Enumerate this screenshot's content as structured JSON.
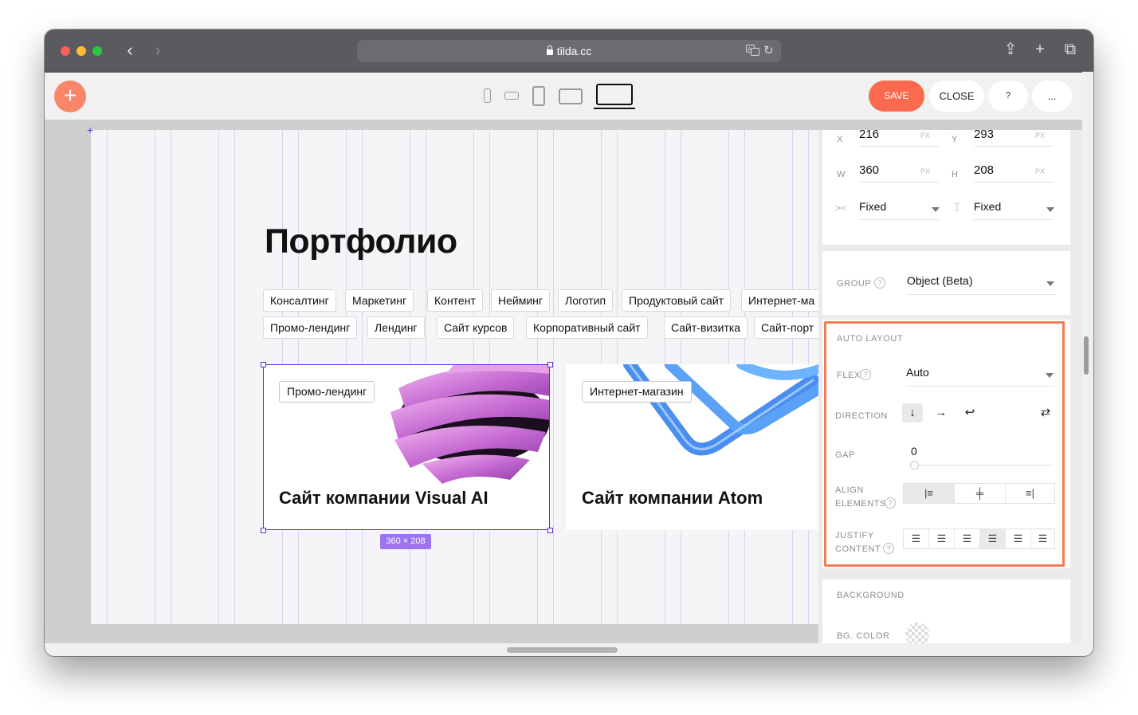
{
  "browser": {
    "url": "tilda.cc",
    "translate_icon": "translate-icon",
    "reload_icon": "reload-icon",
    "back_glyph": "‹",
    "forward_glyph": "›",
    "share_glyph": "⇪",
    "newtab_glyph": "+",
    "tabs_glyph": "⧉"
  },
  "toolbar": {
    "add_glyph": "+",
    "save_label": "SAVE",
    "close_label": "CLOSE",
    "help_label": "?",
    "more_label": "...",
    "accent_color": "#fa6a4e"
  },
  "page": {
    "title": "Портфолио",
    "tags_row1": [
      "Консалтинг",
      "Маркетинг",
      "Контент",
      "Нейминг",
      "Логотип",
      "Продуктовый сайт",
      "Интернет-ма"
    ],
    "tags_row2": [
      "Промо-лендинг",
      "Лендинг",
      "Сайт курсов",
      "Корпоративный сайт",
      "Сайт-визитка",
      "Сайт-порт"
    ],
    "cards": [
      {
        "tag": "Промо-лендинг",
        "title": "Сайт компании Visual AI"
      },
      {
        "tag": "Интернет-магазин",
        "title": "Сайт компании Atom"
      }
    ],
    "selection_size": "360 × 208"
  },
  "panel": {
    "x_label": "X",
    "x_value": "216",
    "x_unit": "PX",
    "y_label": "Y",
    "y_value": "293",
    "y_unit": "PX",
    "w_label": "W",
    "w_value": "360",
    "w_unit": "PX",
    "h_label": "H",
    "h_value": "208",
    "h_unit": "PX",
    "w_mode": "Fixed",
    "h_mode": "Fixed",
    "group_label": "GROUP",
    "group_value": "Object (Beta)",
    "auto_layout_title": "AUTO LAYOUT",
    "flex_label": "FLEX",
    "flex_value": "Auto",
    "direction_label": "DIRECTION",
    "direction_icons": [
      "↓",
      "→",
      "↩",
      "⇄"
    ],
    "gap_label": "GAP",
    "gap_value": "0",
    "align_label_1": "ALIGN",
    "align_label_2": "ELEMENTS",
    "justify_label_1": "JUSTIFY",
    "justify_label_2": "CONTENT",
    "background_title": "BACKGROUND",
    "bg_color_label": "BG. COLOR",
    "highlight_color": "#f47b57"
  }
}
